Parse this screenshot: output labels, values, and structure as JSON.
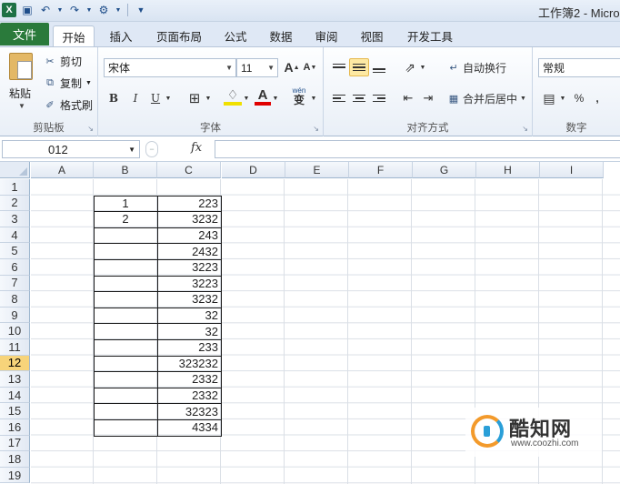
{
  "window": {
    "title": "工作簿2 - Micro"
  },
  "tabs": [
    {
      "label": "文件"
    },
    {
      "label": "开始"
    },
    {
      "label": "插入"
    },
    {
      "label": "页面布局"
    },
    {
      "label": "公式"
    },
    {
      "label": "数据"
    },
    {
      "label": "审阅"
    },
    {
      "label": "视图"
    },
    {
      "label": "开发工具"
    }
  ],
  "ribbon": {
    "clipboard": {
      "paste": "粘贴",
      "cut": "剪切",
      "copy": "复制",
      "format_painter": "格式刷",
      "group": "剪贴板"
    },
    "font": {
      "name": "宋体",
      "size": "11",
      "bold": "B",
      "italic": "I",
      "underline": "U",
      "grow": "A",
      "shrink": "A",
      "group": "字体",
      "wen": "wén",
      "zi": "变"
    },
    "alignment": {
      "wrap": "自动换行",
      "merge": "合并后居中",
      "group": "对齐方式"
    },
    "number": {
      "format": "常规",
      "percent": "%",
      "comma": ",",
      "group": "数字"
    }
  },
  "formula_bar": {
    "name_box": "012",
    "fx": "fx",
    "value": ""
  },
  "sheet": {
    "columns": [
      "A",
      "B",
      "C",
      "D",
      "E",
      "F",
      "G",
      "H",
      "I"
    ],
    "rows": [
      "1",
      "2",
      "3",
      "4",
      "5",
      "6",
      "7",
      "8",
      "9",
      "10",
      "11",
      "12",
      "13",
      "14",
      "15",
      "16",
      "17",
      "18",
      "19"
    ],
    "selected_row": "12",
    "colB": [
      "",
      "1",
      "2",
      "",
      "",
      "",
      "",
      "",
      "",
      "",
      "",
      "",
      "",
      "",
      "",
      ""
    ],
    "colC": [
      "",
      "223",
      "3232",
      "243",
      "2432",
      "3223",
      "3223",
      "3232",
      "32",
      "32",
      "233",
      "323232",
      "2332",
      "2332",
      "32323",
      "4334"
    ]
  },
  "watermark": {
    "name": "酷知网",
    "url": "www.coozhi.com"
  }
}
